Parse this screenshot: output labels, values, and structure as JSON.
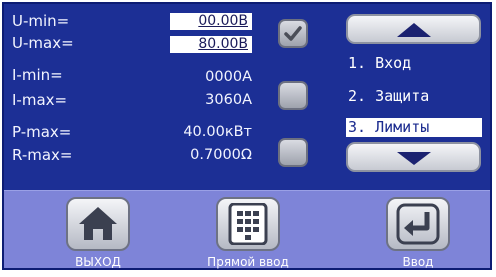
{
  "parameters": [
    {
      "label": "U-min=",
      "value": "00.00В",
      "editable": true
    },
    {
      "label": "U-max=",
      "value": "80.00В",
      "editable": true
    },
    {
      "label": "I-min=",
      "value": "0000А",
      "editable": false
    },
    {
      "label": "I-max=",
      "value": "3060А",
      "editable": false
    },
    {
      "label": "P-max=",
      "value": "40.00кВт",
      "editable": false
    },
    {
      "label": "R-max=",
      "value": "0.7000Ω",
      "editable": false
    }
  ],
  "checkboxes": [
    {
      "icon": "checkmark-icon",
      "checked": true
    },
    {
      "icon": "none",
      "checked": false
    },
    {
      "icon": "none",
      "checked": false
    }
  ],
  "menu": {
    "items": [
      "1. Вход",
      "2. Защита",
      "3. Лимиты"
    ],
    "selected_index": 2,
    "up_icon": "arrow-up-icon",
    "down_icon": "arrow-down-icon"
  },
  "footer": {
    "exit_label": "ВЫХОД",
    "exit_icon": "home-icon",
    "direct_label": "Прямой ввод",
    "direct_icon": "keypad-icon",
    "enter_label": "Ввод",
    "enter_icon": "enter-icon"
  },
  "colors": {
    "panel_bg": "#1c2f95",
    "footer_bg": "#7e84d8",
    "text": "#f2f4ff",
    "highlight": "#ffffff"
  }
}
